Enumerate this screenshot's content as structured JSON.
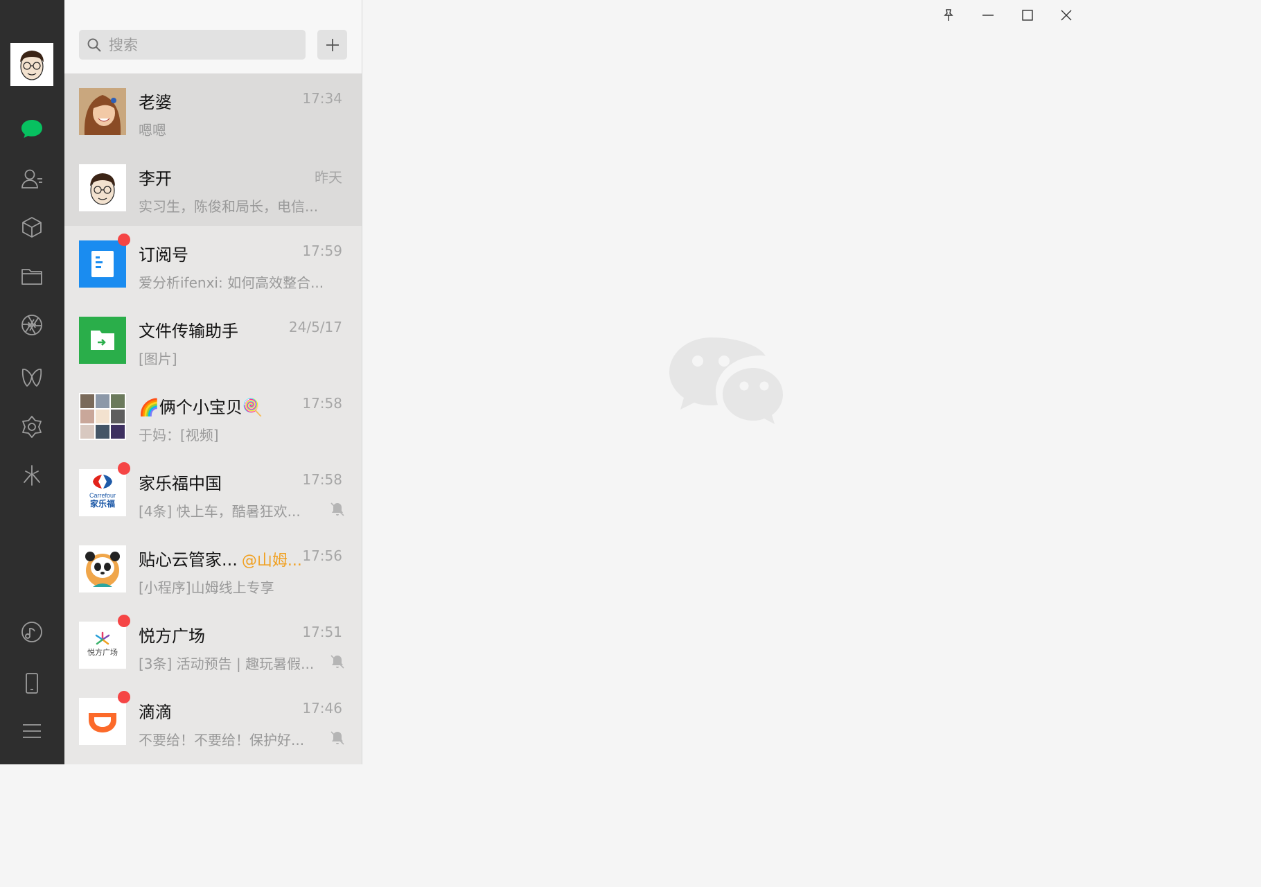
{
  "app": {
    "accent": "#07c160"
  },
  "sidebar": {
    "items": [
      {
        "name": "chats",
        "icon": "chat-bubble-icon",
        "active": true
      },
      {
        "name": "contacts",
        "icon": "contacts-icon"
      },
      {
        "name": "favorites",
        "icon": "cube-icon"
      },
      {
        "name": "files",
        "icon": "folder-icon"
      },
      {
        "name": "moments",
        "icon": "aperture-icon"
      },
      {
        "name": "channels",
        "icon": "butterfly-icon"
      },
      {
        "name": "mini-programs",
        "icon": "hexagon-icon"
      },
      {
        "name": "search",
        "icon": "sparkle-icon"
      },
      {
        "name": "mini-program-panel",
        "icon": "music-icon"
      },
      {
        "name": "phone",
        "icon": "phone-icon"
      },
      {
        "name": "more",
        "icon": "menu-icon"
      }
    ]
  },
  "search": {
    "placeholder": "搜索"
  },
  "chats": [
    {
      "name": "老婆",
      "time": "17:34",
      "preview": "嗯嗯",
      "selected": true
    },
    {
      "name": "李开",
      "time": "昨天",
      "preview": "实习生，陈俊和局长，电信..."
    },
    {
      "name": "订阅号",
      "time": "17:59",
      "preview": "爱分析ifenxi: 如何高效整合...",
      "unread": true
    },
    {
      "name": "文件传输助手",
      "time": "24/5/17",
      "preview": "[图片]"
    },
    {
      "name": "🌈俩个小宝贝🍭",
      "time": "17:58",
      "preview": "于妈：[视频]"
    },
    {
      "name": "家乐福中国",
      "time": "17:58",
      "preview": "[4条] 快上车，酷暑狂欢...",
      "unread": true,
      "muted": true,
      "logo_text": "Carrefour",
      "logo_text_cn": "家乐福"
    },
    {
      "name": "贴心云管家...",
      "mention": "@山姆...",
      "time": "17:56",
      "preview": "[小程序]山姆线上专享"
    },
    {
      "name": "悦方广场",
      "time": "17:51",
      "preview": "[3条] 活动预告 | 趣玩暑假...",
      "unread": true,
      "muted": true,
      "logo_text": "悦方广场"
    },
    {
      "name": "滴滴",
      "time": "17:46",
      "preview": "不要给！不要给！保护好...",
      "unread": true,
      "muted": true
    }
  ],
  "window": {
    "buttons": [
      "pin-icon",
      "minimize-icon",
      "maximize-icon",
      "close-icon"
    ]
  }
}
